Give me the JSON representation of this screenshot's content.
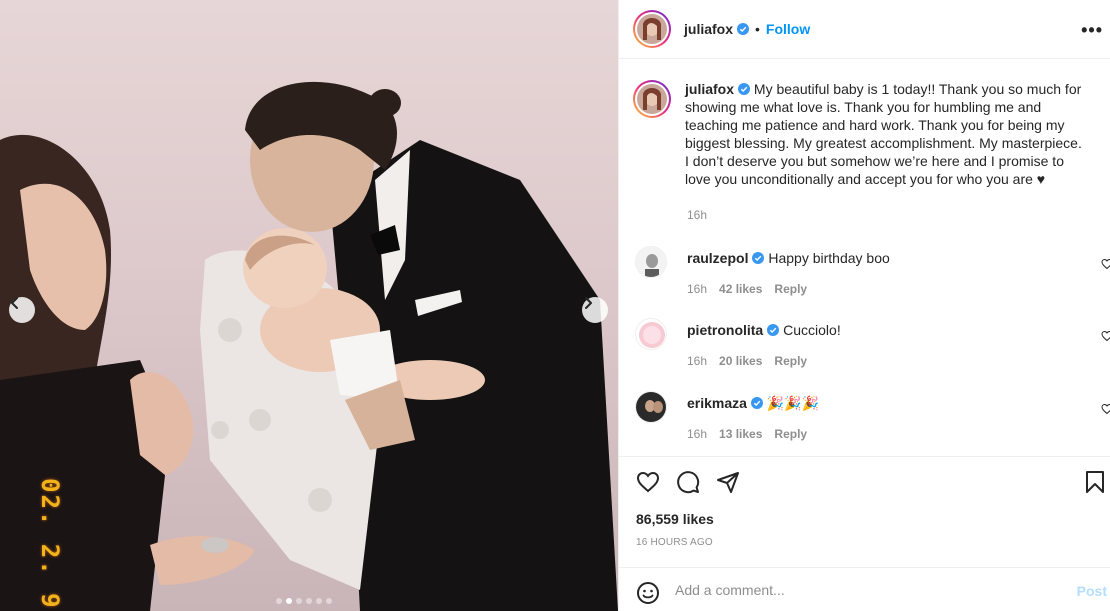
{
  "post": {
    "author": "juliafox",
    "follow_label": "Follow",
    "bullet": "•",
    "more_label": "•••",
    "caption": "My beautiful baby is 1 today!! Thank you so much for showing me what love is. Thank you for humbling me and teaching me patience and hard work. Thank you for being my biggest blessing. My greatest accomplishment. My masterpiece. I don’t deserve you but somehow we’re here and I promise to love you unconditionally and accept you for who you are ♥",
    "caption_time": "16h",
    "likes": "86,559 likes",
    "time_ago": "16 HOURS AGO",
    "photo_date_stamp": "02. 2. 9",
    "carousel": {
      "count": 6,
      "active": 1
    }
  },
  "comments": [
    {
      "user": "raulzepol",
      "text": "Happy birthday boo",
      "time": "16h",
      "likes": "42 likes",
      "reply": "Reply"
    },
    {
      "user": "pietronolita",
      "text": "Cucciolo!",
      "time": "16h",
      "likes": "20 likes",
      "reply": "Reply"
    },
    {
      "user": "erikmaza",
      "text": "🎉🎉🎉",
      "time": "16h",
      "likes": "13 likes",
      "reply": "Reply"
    }
  ],
  "composer": {
    "placeholder": "Add a comment...",
    "post_label": "Post"
  },
  "icons": [
    "chevron-left-icon",
    "chevron-right-icon",
    "verified-icon",
    "more-icon",
    "heart-icon",
    "comment-icon",
    "share-icon",
    "bookmark-icon",
    "emoji-icon"
  ],
  "colors": {
    "accent": "#0095f6",
    "verified": "#3897f0",
    "muted": "#8e8e8e",
    "date_stamp": "#f2b21a"
  }
}
